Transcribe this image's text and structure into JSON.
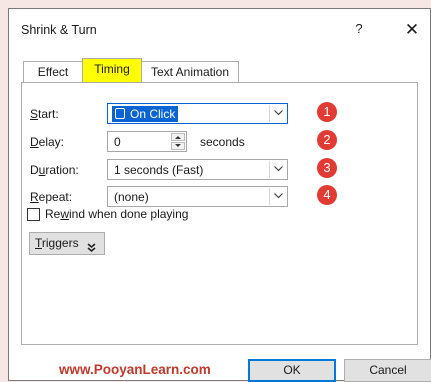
{
  "window": {
    "title": "Shrink & Turn",
    "help_glyph": "?",
    "close_glyph": "✕"
  },
  "tabs": [
    {
      "label": "Effect",
      "active": false
    },
    {
      "label": "Timing",
      "active": true
    },
    {
      "label": "Text Animation",
      "active": false
    }
  ],
  "fields": {
    "start": {
      "label_pre": "",
      "label_u": "S",
      "label_post": "tart:",
      "value": "On Click",
      "badge": "1"
    },
    "delay": {
      "label_u": "D",
      "label_post": "elay:",
      "value": "0",
      "unit": "seconds",
      "badge": "2"
    },
    "duration": {
      "label_pre": "D",
      "label_u": "u",
      "label_post": "ration:",
      "value": "1 seconds (Fast)",
      "badge": "3"
    },
    "repeat": {
      "label_u": "R",
      "label_post": "epeat:",
      "value": "(none)",
      "badge": "4"
    }
  },
  "rewind": {
    "label_pre": "Re",
    "label_u": "w",
    "label_post": "ind when done playing",
    "checked": false
  },
  "triggers": {
    "label_u": "T",
    "label_post": "riggers",
    "glyph": "⯯"
  },
  "watermark": "www.PooyanLearn.com",
  "buttons": {
    "ok": "OK",
    "cancel": "Cancel"
  },
  "colors": {
    "active_tab": "#ffff00",
    "badge": "#e23b33",
    "selection": "#0a64d4",
    "watermark": "#c0392b"
  }
}
